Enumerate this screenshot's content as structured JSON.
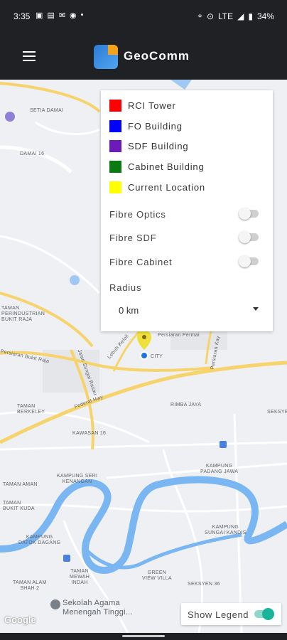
{
  "status_bar": {
    "time": "3:35",
    "network": "LTE",
    "battery": "34%"
  },
  "app": {
    "title": "GeoComm"
  },
  "legend": {
    "items": [
      {
        "label": "RCI Tower",
        "color": "#ff0000"
      },
      {
        "label": "FO Building",
        "color": "#0000ff"
      },
      {
        "label": "SDF Building",
        "color": "#6a1bb8"
      },
      {
        "label": "Cabinet Building",
        "color": "#0a7a13"
      },
      {
        "label": "Current Location",
        "color": "#ffff00"
      }
    ],
    "toggles": [
      {
        "label": "Fibre Optics",
        "on": false
      },
      {
        "label": "Fibre SDF",
        "on": false
      },
      {
        "label": "Fibre Cabinet",
        "on": false
      }
    ],
    "radius_label": "Radius",
    "radius_value": "0 km"
  },
  "show_legend": {
    "label": "Show Legend",
    "on": true
  },
  "map": {
    "attribution": "Google",
    "labels": {
      "setia_damai": "SETIA DAMAI",
      "damai16": "DAMAI 16",
      "taman_perindustrian": "TAMAN\nPERINDUSTRIAN\nBUKIT RAJA",
      "persiaran_permai": "Persiaran Permai",
      "lebuh_keluli": "Lebuh Keluli",
      "city": "CITY",
      "persiaran_kayangan": "Persiaran Kay",
      "persiaran_bukit_raja": "Persiaran Bukit Raja",
      "jalan_sungai_rasau": "Jalan Sungai Rasau",
      "taman_berkeley": "TAMAN\nBERKELEY",
      "federal_hwy": "Federal Hwy",
      "rimba_jaya": "RIMBA JAYA",
      "seksyen": "SEKSYE",
      "kawasan16": "KAWASAN 16",
      "kampung_seri_kenangan": "KAMPUNG SERI\nKENANGAN",
      "kampung_padang_jawa": "KAMPUNG\nPADANG JAWA",
      "taman_aman": "TAMAN AMAN",
      "taman_bukit_kuda": "TAMAN\nBUKIT KUDA",
      "kampung_sungai_kandis": "KAMPUNG\nSUNGAI KANDIS",
      "kampung_datok_dagang": "KAMPUNG\nDATOK DAGANG",
      "taman_mewah_indah": "TAMAN\nMEWAH\nINDAH",
      "taman_alam_shah": "TAMAN ALAM\nSHAH 2",
      "green_view_villa": "GREEN\nVIEW VILLA",
      "seksyen36": "SEKSYEN 36",
      "sekolah": "Sekolah Agama\nMenengah Tinggi..."
    }
  }
}
